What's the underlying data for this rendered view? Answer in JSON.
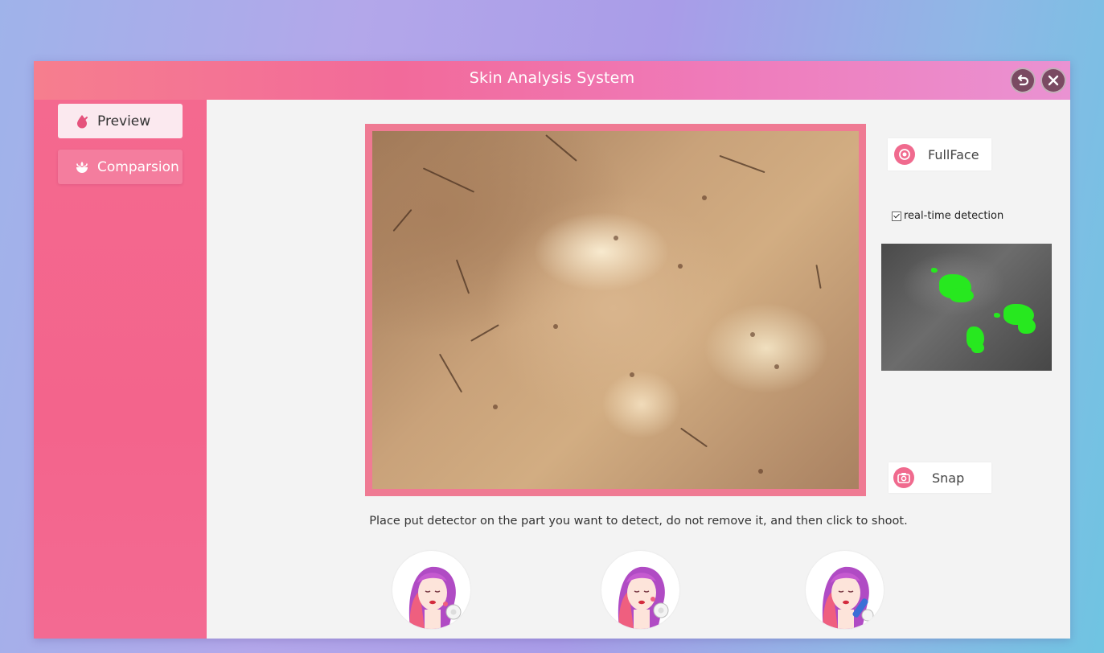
{
  "window": {
    "title": "Skin Analysis System",
    "accent_color": "#f26a9a"
  },
  "titlebar": {
    "back_icon": "back-arrow-icon",
    "close_icon": "close-icon"
  },
  "sidebar": {
    "items": [
      {
        "label": "Preview",
        "icon": "drop-icon",
        "selected": true
      },
      {
        "label": "Comparsion",
        "icon": "lotus-icon",
        "selected": false
      }
    ]
  },
  "main": {
    "fullface_label": "FullFace",
    "snap_label": "Snap",
    "realtime_label": "real-time detection",
    "realtime_checked": true,
    "instruction": "Place put detector on the part you want to detect, do not remove it, and then click to shoot.",
    "highlight_color": "#27e81f",
    "avatars": [
      {
        "icon": "face-with-detector-icon"
      },
      {
        "icon": "face-with-detector-icon"
      },
      {
        "icon": "face-with-detector-pen-icon"
      }
    ]
  }
}
